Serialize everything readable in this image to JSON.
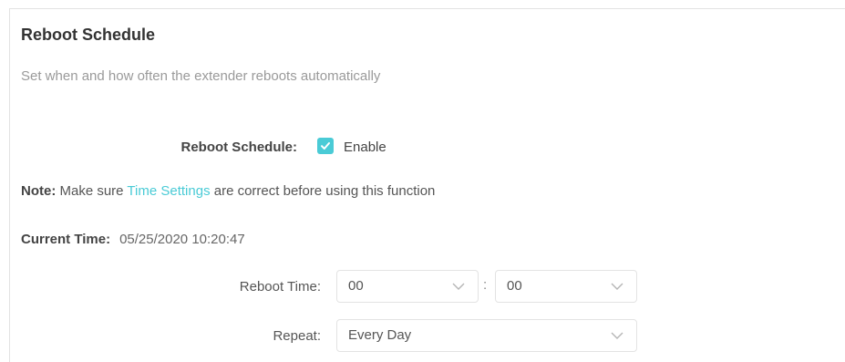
{
  "section": {
    "title": "Reboot Schedule",
    "description": "Set when and how often the extender reboots automatically"
  },
  "schedule": {
    "label": "Reboot Schedule:",
    "enable_label": "Enable",
    "enabled": true
  },
  "note": {
    "prefix": "Note:",
    "text_before": " Make sure ",
    "link": "Time Settings",
    "text_after": " are correct before using this function"
  },
  "current_time": {
    "label": "Current Time:",
    "value": "05/25/2020 10:20:47"
  },
  "reboot_time": {
    "label": "Reboot Time:",
    "hour": "00",
    "separator": ":",
    "minute": "00"
  },
  "repeat": {
    "label": "Repeat:",
    "value": "Every Day"
  },
  "icons": {
    "checkbox": "check-icon",
    "dropdown": "chevron-down-icon"
  },
  "colors": {
    "accent": "#4acbd6"
  }
}
